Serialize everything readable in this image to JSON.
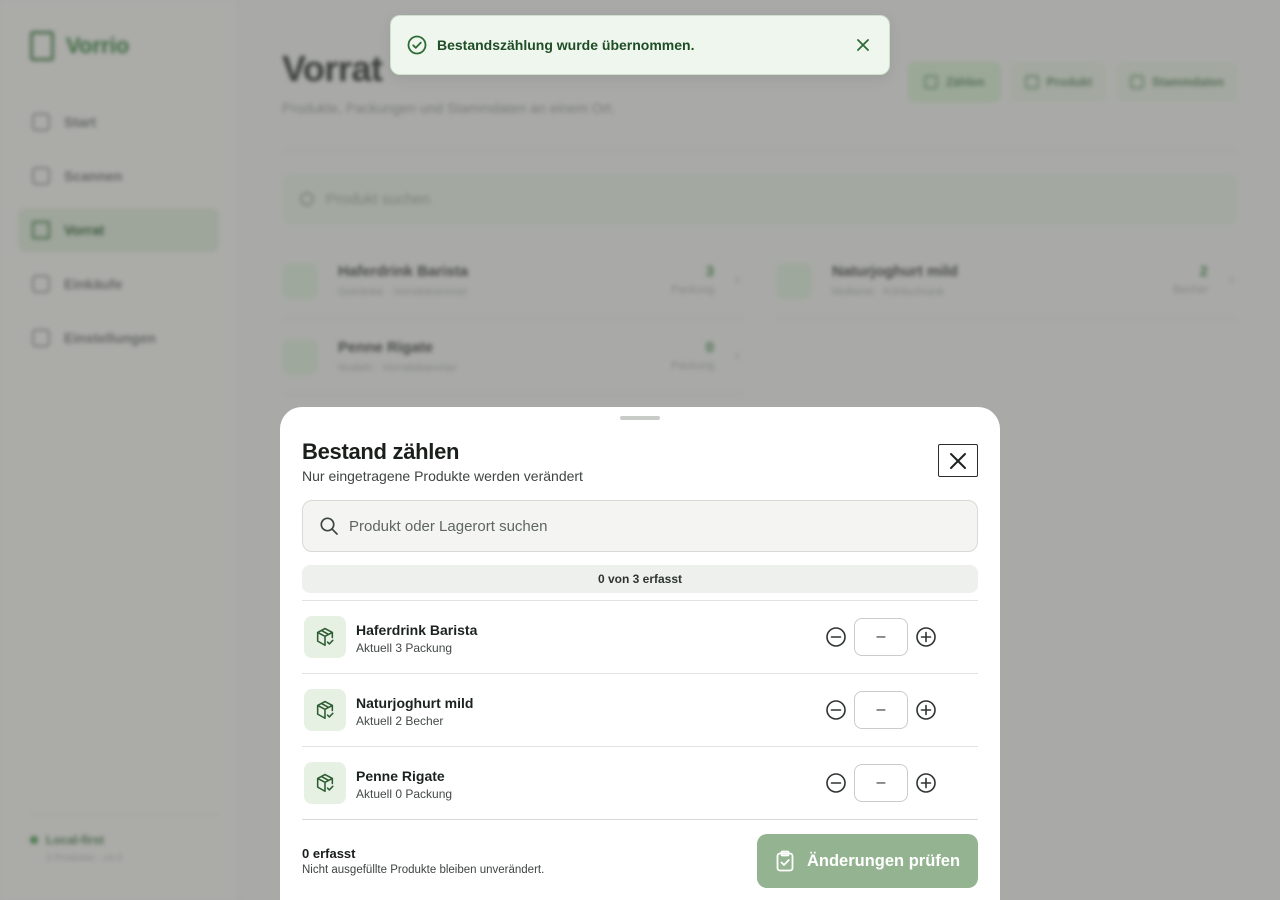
{
  "app": {
    "brand": "Vorrio",
    "nav": [
      {
        "label": "Start",
        "icon": "home-icon"
      },
      {
        "label": "Scannen",
        "icon": "barcode-icon"
      },
      {
        "label": "Vorrat",
        "icon": "box-icon",
        "active": true
      },
      {
        "label": "Einkäufe",
        "icon": "history-icon"
      },
      {
        "label": "Einstellungen",
        "icon": "gear-icon"
      }
    ],
    "status": {
      "label": "Local-first",
      "sub": "3 Produkte · v4.0"
    }
  },
  "page": {
    "title": "Vorrat",
    "subtitle": "Produkte, Packungen und Stammdaten an einem Ort.",
    "actions": [
      "Zählen",
      "Produkt",
      "Stammdaten"
    ],
    "search_placeholder": "Produkt suchen",
    "products": [
      {
        "name": "Haferdrink Barista",
        "meta": "Getränke · Vorratskammer",
        "qty": "3",
        "unit": "Packung"
      },
      {
        "name": "Naturjoghurt mild",
        "meta": "Molkerei · Kühlschrank",
        "qty": "2",
        "unit": "Becher"
      },
      {
        "name": "Penne Rigate",
        "meta": "Nudeln · Vorratskammer",
        "qty": "0",
        "unit": "Packung"
      }
    ]
  },
  "toast": {
    "message": "Bestandszählung wurde übernommen.",
    "status_color": "#2e6b35"
  },
  "sheet": {
    "title": "Bestand zählen",
    "subtitle": "Nur eingetragene Produkte werden verändert",
    "search_placeholder": "Produkt oder Lagerort suchen",
    "progress": {
      "text": "0 von 3 erfasst",
      "counted": 0,
      "total": 3
    },
    "items": [
      {
        "name": "Haferdrink Barista",
        "current": "Aktuell 3 Packung",
        "placeholder": "–"
      },
      {
        "name": "Naturjoghurt mild",
        "current": "Aktuell 2 Becher",
        "placeholder": "–"
      },
      {
        "name": "Penne Rigate",
        "current": "Aktuell 0 Packung",
        "placeholder": "–"
      }
    ],
    "footer": {
      "count": "0 erfasst",
      "hint": "Nicht ausgefüllte Produkte bleiben unverändert.",
      "submit_label": "Änderungen prüfen"
    }
  },
  "colors": {
    "accent": "#93b391",
    "brand": "#3f6b43",
    "toast_bg": "#eef6ed"
  }
}
